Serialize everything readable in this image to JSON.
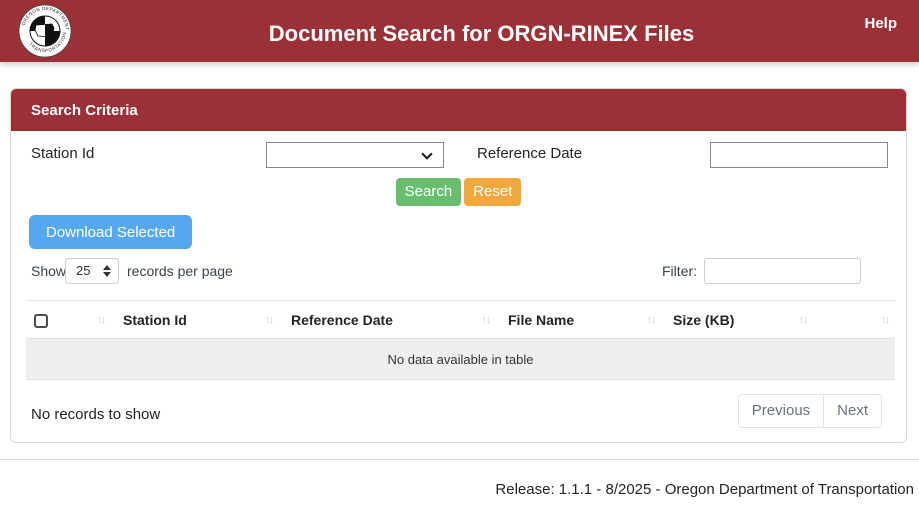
{
  "header": {
    "title": "Document Search for ORGN-RINEX Files",
    "help_label": "Help",
    "logo": "oregon-department-of-transportation-seal"
  },
  "search_panel": {
    "title": "Search Criteria",
    "station_id_label": "Station Id",
    "station_id_selected": "",
    "reference_date_label": "Reference Date",
    "reference_date_value": "",
    "search_button": "Search",
    "reset_button": "Reset"
  },
  "toolbar": {
    "download_button": "Download Selected",
    "show_label": "Show",
    "page_size_value": "25",
    "records_label": "records per page",
    "filter_label": "Filter:",
    "filter_value": ""
  },
  "table": {
    "columns": [
      {
        "label": "",
        "sortable": true,
        "has_checkbox": true
      },
      {
        "label": "Station Id",
        "sortable": true
      },
      {
        "label": "Reference Date",
        "sortable": true
      },
      {
        "label": "File Name",
        "sortable": true
      },
      {
        "label": "Size (KB)",
        "sortable": true
      },
      {
        "label": "",
        "sortable": true
      }
    ],
    "sort_glyph": "↑↓",
    "empty_message": "No data available in table",
    "rows": [],
    "summary": "No records to show"
  },
  "pagination": {
    "previous_label": "Previous",
    "next_label": "Next"
  },
  "footer": {
    "release_text": "Release: 1.1.1 - 8/2025 - Oregon Department of Transportation"
  },
  "colors": {
    "header_maroon": "#9b3136",
    "search_green": "#69be6e",
    "reset_orange": "#f1a73e",
    "download_blue": "#55a7f0",
    "empty_row_gray": "#efefef"
  }
}
